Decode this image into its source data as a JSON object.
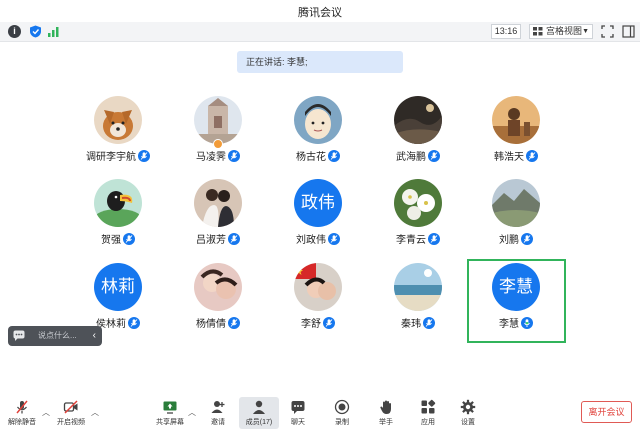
{
  "window": {
    "title": "腾讯会议"
  },
  "toolbar": {
    "time": "13:16",
    "view_label": "宫格视图"
  },
  "banner": {
    "speaking_text": "正在讲话: 李慧;"
  },
  "participants": [
    {
      "name": "调研李宇航",
      "avatar_text": ""
    },
    {
      "name": "马凌霁",
      "avatar_text": ""
    },
    {
      "name": "杨古花",
      "avatar_text": ""
    },
    {
      "name": "武海鹏",
      "avatar_text": ""
    },
    {
      "name": "韩浩天",
      "avatar_text": ""
    },
    {
      "name": "贺强",
      "avatar_text": ""
    },
    {
      "name": "吕淑芳",
      "avatar_text": ""
    },
    {
      "name": "刘政伟",
      "avatar_text": "政伟"
    },
    {
      "name": "李青云",
      "avatar_text": ""
    },
    {
      "name": "刘鹏",
      "avatar_text": ""
    },
    {
      "name": "侯林莉",
      "avatar_text": "林莉"
    },
    {
      "name": "杨倩倩",
      "avatar_text": ""
    },
    {
      "name": "李舒",
      "avatar_text": ""
    },
    {
      "name": "秦玮",
      "avatar_text": ""
    },
    {
      "name": "李慧",
      "avatar_text": "李慧"
    }
  ],
  "chat": {
    "placeholder": "说点什么..."
  },
  "bottom": {
    "unmute": "解除静音",
    "start_video": "开启视频",
    "share_screen": "共享屏幕",
    "invite": "邀请",
    "members": "成员(17)",
    "chat": "聊天",
    "record": "录制",
    "raise_hand": "举手",
    "apps": "应用",
    "settings": "设置",
    "leave": "离开会议"
  },
  "colors": {
    "accent": "#1677ee",
    "active_speaker": "#31b45b",
    "leave": "#e0413a"
  }
}
